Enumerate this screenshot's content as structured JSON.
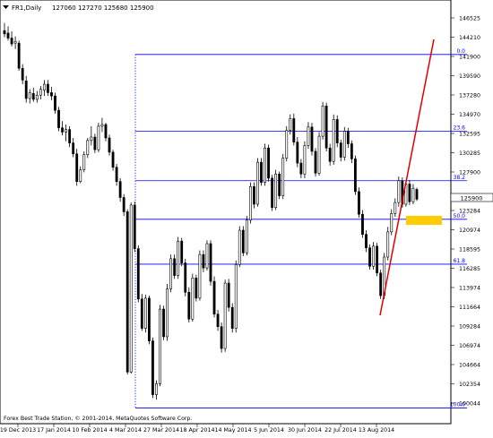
{
  "header": {
    "symbol_label": "FR1,Daily",
    "ohlc_values": "127060 127270 125680 125900"
  },
  "current_price": "125900",
  "footer_copyright": "Forex Best Trade Station, © 2001-2014, MetaQuotes Software Corp.",
  "colors": {
    "background": "#ffffff",
    "candle_bull": "#ffffff",
    "candle_bear": "#000000",
    "fib_lines": "#0000ff",
    "trend_line": "#e00000",
    "highlight_box": "#ffcc00",
    "grid": "#c0c0c0"
  },
  "chart_data": {
    "type": "candlestick",
    "ylim": [
      100740,
      148040
    ],
    "y_ticks": [
      "146525",
      "144210",
      "141900",
      "139590",
      "137280",
      "134970",
      "132595",
      "130285",
      "127900",
      "125900",
      "123284",
      "120974",
      "118595",
      "116285",
      "113974",
      "111664",
      "109284",
      "106974",
      "104664",
      "102354",
      "100044"
    ],
    "x_ticks": [
      "19 Dec 2013",
      "17 Jan 2014",
      "10 Feb 2014",
      "4 Mar 2014",
      "27 Mar 2014",
      "18 Apr 2014",
      "14 May 2014",
      "5 Jun 2014",
      "30 Jun 2014",
      "22 Jul 2014",
      "13 Aug 2014"
    ],
    "fibonacci_levels": [
      {
        "label": "0.0",
        "price": 143150
      },
      {
        "label": "23.6",
        "price": 134000
      },
      {
        "label": "38.2",
        "price": 128100
      },
      {
        "label": "50.0",
        "price": 123500
      },
      {
        "label": "61.8",
        "price": 118150
      },
      {
        "label": "100.0",
        "price": 101000
      }
    ],
    "bars": [
      [
        146000,
        146900,
        145200,
        145600
      ],
      [
        145700,
        146500,
        144800,
        145100
      ],
      [
        145100,
        145900,
        144100,
        144400
      ],
      [
        144500,
        145300,
        143800,
        144700
      ],
      [
        144500,
        144800,
        141200,
        141500
      ],
      [
        141500,
        142000,
        139600,
        140100
      ],
      [
        140000,
        140600,
        137400,
        137900
      ],
      [
        137900,
        139000,
        137300,
        138600
      ],
      [
        138500,
        139200,
        137500,
        137800
      ],
      [
        137800,
        138800,
        137400,
        138300
      ],
      [
        138300,
        139400,
        137800,
        139000
      ],
      [
        138900,
        140100,
        138200,
        139600
      ],
      [
        139600,
        140100,
        138200,
        138600
      ],
      [
        138600,
        139300,
        137700,
        138200
      ],
      [
        138200,
        138600,
        136100,
        136500
      ],
      [
        136500,
        136900,
        134000,
        134400
      ],
      [
        134400,
        135200,
        133500,
        133900
      ],
      [
        133900,
        134800,
        132800,
        134200
      ],
      [
        134200,
        134600,
        132100,
        132600
      ],
      [
        132600,
        133200,
        130900,
        131300
      ],
      [
        131300,
        131900,
        127500,
        128000
      ],
      [
        128000,
        129800,
        127800,
        129400
      ],
      [
        129400,
        131600,
        129100,
        131200
      ],
      [
        131200,
        133200,
        130800,
        132900
      ],
      [
        132900,
        134600,
        132300,
        133300
      ],
      [
        133300,
        133700,
        131400,
        131800
      ],
      [
        131800,
        135000,
        131500,
        134600
      ],
      [
        134600,
        135600,
        133900,
        134800
      ],
      [
        134800,
        135000,
        132800,
        133200
      ],
      [
        133200,
        133600,
        131100,
        131500
      ],
      [
        131500,
        131800,
        129300,
        129700
      ],
      [
        129700,
        130100,
        127500,
        128000
      ],
      [
        128000,
        128400,
        125600,
        126100
      ],
      [
        126100,
        126500,
        123900,
        124400
      ],
      [
        124400,
        124700,
        105000,
        105300
      ],
      [
        105300,
        125500,
        105100,
        125200
      ],
      [
        125200,
        125600,
        119600,
        120000
      ],
      [
        120000,
        120400,
        113600,
        114000
      ],
      [
        114000,
        114600,
        110200,
        110500
      ],
      [
        110500,
        114500,
        110000,
        114100
      ],
      [
        114100,
        114400,
        108600,
        109000
      ],
      [
        109000,
        109400,
        102200,
        102600
      ],
      [
        102600,
        104300,
        102000,
        103900
      ],
      [
        103900,
        113300,
        103600,
        112800
      ],
      [
        112800,
        113200,
        109100,
        109500
      ],
      [
        109500,
        115800,
        109000,
        115200
      ],
      [
        115200,
        119300,
        114800,
        118800
      ],
      [
        118800,
        119300,
        116400,
        116800
      ],
      [
        116800,
        121400,
        116400,
        120900
      ],
      [
        120900,
        121300,
        117900,
        118300
      ],
      [
        118300,
        118800,
        114300,
        114800
      ],
      [
        114800,
        115400,
        111200,
        111600
      ],
      [
        111600,
        117000,
        111300,
        116500
      ],
      [
        116500,
        116900,
        113700,
        114100
      ],
      [
        114100,
        119800,
        113800,
        119300
      ],
      [
        119300,
        119800,
        117200,
        117700
      ],
      [
        117700,
        121000,
        117400,
        120600
      ],
      [
        120600,
        121000,
        115600,
        116100
      ],
      [
        116100,
        116700,
        111800,
        112200
      ],
      [
        112200,
        112700,
        110200,
        110700
      ],
      [
        110700,
        111200,
        107600,
        108100
      ],
      [
        108100,
        116300,
        107700,
        115900
      ],
      [
        115900,
        116400,
        112500,
        113000
      ],
      [
        113000,
        113500,
        110000,
        110500
      ],
      [
        110500,
        118600,
        110000,
        118100
      ],
      [
        118100,
        122700,
        117800,
        122200
      ],
      [
        122200,
        122700,
        119100,
        119500
      ],
      [
        119500,
        123900,
        119200,
        123400
      ],
      [
        123400,
        127900,
        123000,
        127400
      ],
      [
        127400,
        127900,
        124800,
        125300
      ],
      [
        125300,
        130800,
        125000,
        130300
      ],
      [
        130300,
        130800,
        127500,
        127900
      ],
      [
        127900,
        132500,
        127500,
        132000
      ],
      [
        132000,
        132400,
        128000,
        128400
      ],
      [
        128400,
        128800,
        124500,
        124900
      ],
      [
        124900,
        129400,
        124600,
        128900
      ],
      [
        128900,
        129200,
        125900,
        126300
      ],
      [
        126300,
        131300,
        125900,
        130800
      ],
      [
        130800,
        134600,
        130400,
        134100
      ],
      [
        134100,
        136000,
        133600,
        135500
      ],
      [
        135500,
        136100,
        132300,
        132700
      ],
      [
        132700,
        133300,
        129700,
        130200
      ],
      [
        130200,
        130700,
        128400,
        128900
      ],
      [
        128900,
        132800,
        128400,
        132300
      ],
      [
        132300,
        135100,
        131900,
        134500
      ],
      [
        134500,
        135000,
        131100,
        131600
      ],
      [
        131600,
        132000,
        128600,
        129000
      ],
      [
        129000,
        133900,
        128700,
        133400
      ],
      [
        133400,
        137500,
        133000,
        137000
      ],
      [
        137000,
        137400,
        131600,
        132000
      ],
      [
        132000,
        132500,
        129900,
        130400
      ],
      [
        130400,
        136000,
        130000,
        135400
      ],
      [
        135400,
        135900,
        132100,
        132600
      ],
      [
        132600,
        133000,
        130400,
        130900
      ],
      [
        130900,
        134500,
        130500,
        134000
      ],
      [
        134000,
        134400,
        132000,
        132500
      ],
      [
        132500,
        132900,
        130200,
        130700
      ],
      [
        130700,
        131100,
        126400,
        126800
      ],
      [
        126800,
        127300,
        123700,
        124100
      ],
      [
        124100,
        124600,
        121300,
        121700
      ],
      [
        121700,
        122200,
        119600,
        120100
      ],
      [
        120100,
        120500,
        117500,
        117900
      ],
      [
        117900,
        120800,
        117500,
        120300
      ],
      [
        120300,
        120700,
        116700,
        117100
      ],
      [
        117100,
        117500,
        114000,
        114400
      ],
      [
        114400,
        119500,
        114000,
        119000
      ],
      [
        119000,
        122600,
        118600,
        122000
      ],
      [
        122000,
        124700,
        121600,
        124200
      ],
      [
        124200,
        126000,
        123800,
        125500
      ],
      [
        125500,
        128600,
        125000,
        128100
      ],
      [
        128100,
        128500,
        124900,
        125300
      ],
      [
        125300,
        128100,
        125000,
        127700
      ],
      [
        127700,
        128200,
        125200,
        125600
      ],
      [
        125600,
        127700,
        125300,
        127200
      ],
      [
        127060,
        127270,
        125680,
        125900
      ]
    ]
  }
}
